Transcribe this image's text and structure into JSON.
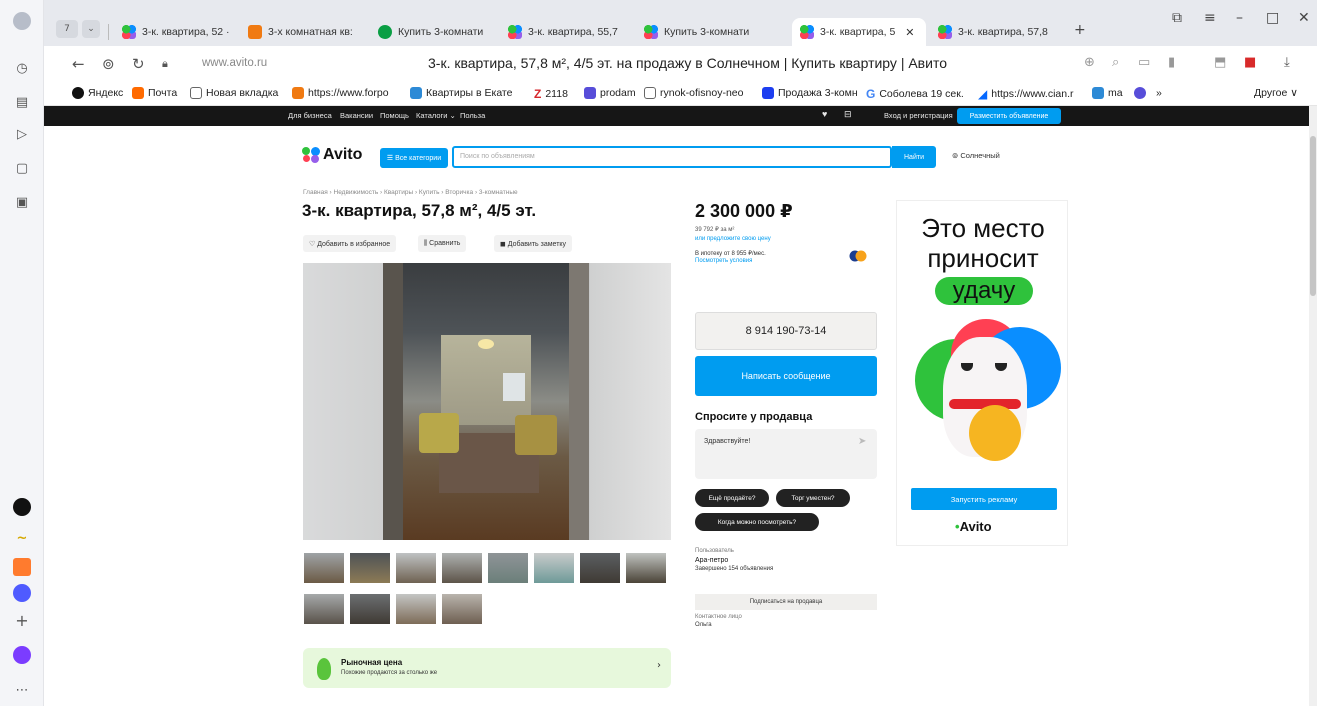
{
  "browser": {
    "tabs": [
      {
        "label": "3-к. квартира, 52 ·",
        "icon": "avito"
      },
      {
        "label": "3-х комнатная кв:",
        "icon": "orange"
      },
      {
        "label": "Купить 3-комнати",
        "icon": "green"
      },
      {
        "label": "3-к. квартира, 55,7",
        "icon": "avito"
      },
      {
        "label": "Купить 3-комнати",
        "icon": "avito"
      },
      {
        "label": "3-к. квартира, 5",
        "icon": "avito",
        "active": true
      },
      {
        "label": "3-к. квартира, 57,8",
        "icon": "avito"
      }
    ],
    "tab_count_badge": "7",
    "url": "www.avito.ru",
    "page_title": "3-к. квартира, 57,8 м², 4/5 эт. на продажу в Солнечном | Купить квартиру | Авито",
    "bookmarks": [
      {
        "label": "Яндекс",
        "icon": "black"
      },
      {
        "label": "Почта",
        "icon": "mail"
      },
      {
        "label": "Новая вкладка",
        "icon": "doc"
      },
      {
        "label": "https://www.forpo",
        "icon": "orange"
      },
      {
        "label": "Квартиры в Екате",
        "icon": "blue"
      },
      {
        "label": "2118",
        "icon": "red-z"
      },
      {
        "label": "prodam",
        "icon": "purple"
      },
      {
        "label": "rynok-ofisnoy-neo",
        "icon": "doc"
      },
      {
        "label": "Продажа 3-комн",
        "icon": "m"
      },
      {
        "label": "Соболева 19 сек.",
        "icon": "g"
      },
      {
        "label": "https://www.cian.r",
        "icon": "cian"
      },
      {
        "label": "ma",
        "icon": "blue"
      },
      {
        "label": "»",
        "icon": "none"
      },
      {
        "label": "Другое ∨",
        "icon": "none"
      }
    ]
  },
  "site": {
    "topbar": {
      "links": [
        "Для бизнеса",
        "Вакансии",
        "Помощь",
        "Каталоги ⌄",
        "Польза"
      ],
      "login": "Вход и регистрация",
      "post_button": "Разместить объявление"
    },
    "logo": "Avito",
    "all_categories": "☰ Все категории",
    "search_placeholder": "Поиск по объявлениям",
    "search_button": "Найти",
    "location": "⊚ Солнечный"
  },
  "listing": {
    "breadcrumbs": "Главная › Недвижимость › Квартиры › Купить › Вторичка › 3-комнатные",
    "title": "3-к. квартира, 57,8 м², 4/5 эт.",
    "actions": [
      "♡ Добавить в избранное",
      "⫼ Сравнить",
      "◼ Добавить заметку"
    ],
    "price": "2 300 000 ₽",
    "price_per_meter": "39 792 ₽ за м²",
    "offer_link": "или предложите свою цену",
    "mortgage": "В ипотеку от 8 955 ₽/мес.",
    "mortgage_link": "Посмотреть условия",
    "phone": "8 914 190-73-14",
    "write_message": "Написать сообщение",
    "ask_title": "Спросите у продавца",
    "ask_placeholder": "Здравствуйте!",
    "quick_questions": [
      "Ещё продаёте?",
      "Торг уместен?",
      "Когда можно посмотреть?"
    ],
    "seller_label": "Пользователь",
    "seller_name": "Ара-петро",
    "seller_stats": "Завершено 154 объявления",
    "subscribe": "Подписаться на продавца",
    "contact_label": "Контактное лицо",
    "contact_name": "Ольга",
    "market_title": "Рыночная цена",
    "market_sub": "Похожие продаются за столько же"
  },
  "ad": {
    "line1": "Это место",
    "line2": "приносит",
    "highlight": "удачу",
    "button": "Запустить рекламу",
    "logo": "Avito"
  },
  "colors": {
    "accent": "#009cf0",
    "avito_green": "#2fc23c",
    "topbar": "#161616"
  }
}
